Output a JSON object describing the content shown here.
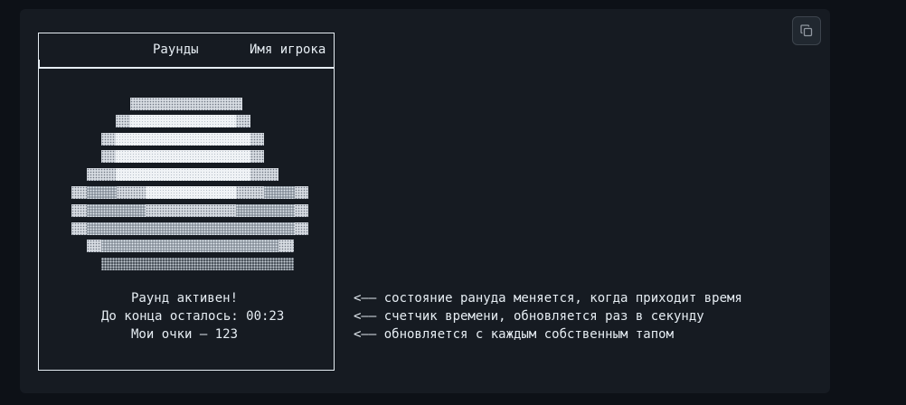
{
  "header": {
    "rounds_label": "Раунды",
    "player_label": "Имя игрока"
  },
  "status": {
    "round_text": "Раунд активен!",
    "timer_text": "До конца осталось: 00:23",
    "score_text": "Мои очки — 123"
  },
  "annotations": [
    "<—— состояние рануда меняется, когда приходит время",
    "<—— счетчик времени, обновляется раз в секунду",
    "<—— обновляется с каждым собственным тапом"
  ],
  "toolbar": {
    "copy_icon": "copy-icon"
  },
  "colors": {
    "page_bg": "#0d1117",
    "panel_bg": "#161b22",
    "text": "#e6edf3"
  }
}
